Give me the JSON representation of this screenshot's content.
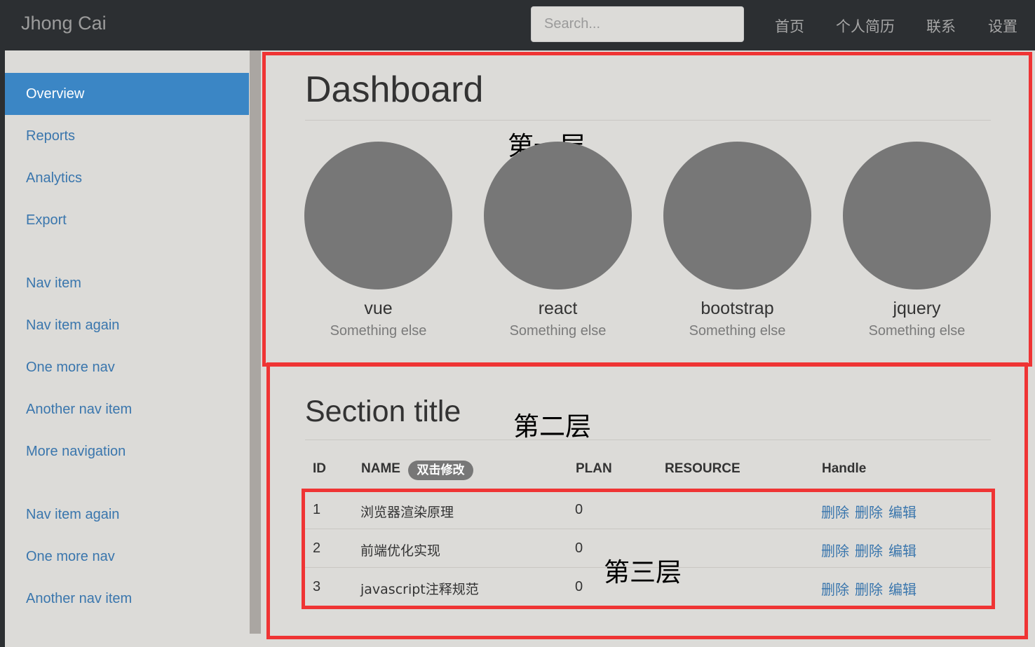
{
  "navbar": {
    "brand": "Jhong Cai",
    "search_placeholder": "Search...",
    "links": [
      "首页",
      "个人简历",
      "联系",
      "设置"
    ]
  },
  "sidebar": {
    "group1": [
      "Overview",
      "Reports",
      "Analytics",
      "Export"
    ],
    "group2": [
      "Nav item",
      "Nav item again",
      "One more nav",
      "Another nav item",
      "More navigation"
    ],
    "group3": [
      "Nav item again",
      "One more nav",
      "Another nav item"
    ],
    "active_item": "Overview"
  },
  "dashboard": {
    "title": "Dashboard",
    "placeholders": [
      {
        "name": "vue",
        "sub": "Something else"
      },
      {
        "name": "react",
        "sub": "Something else"
      },
      {
        "name": "bootstrap",
        "sub": "Something else"
      },
      {
        "name": "jquery",
        "sub": "Something else"
      }
    ]
  },
  "section": {
    "title": "Section title",
    "columns": {
      "id": "ID",
      "name": "NAME",
      "name_badge": "双击修改",
      "plan": "PLAN",
      "resource": "RESOURCE",
      "handle": "Handle"
    },
    "rows": [
      {
        "id": "1",
        "name": "浏览器渲染原理",
        "plan": "0",
        "resource": "",
        "actions": [
          "删除",
          "删除",
          "编辑"
        ]
      },
      {
        "id": "2",
        "name": "前端优化实现",
        "plan": "0",
        "resource": "",
        "actions": [
          "删除",
          "删除",
          "编辑"
        ]
      },
      {
        "id": "3",
        "name": "javascript注释规范",
        "plan": "0",
        "resource": "",
        "actions": [
          "删除",
          "删除",
          "编辑"
        ]
      }
    ]
  },
  "annotations": {
    "layer1": "第一层",
    "layer2": "第二层",
    "layer3": "第三层",
    "box_color": "#ef3434"
  },
  "colors": {
    "accent": "#3b86c5",
    "link": "#3a76ad",
    "navbar_bg": "#2c2f32",
    "page_bg": "#dcdbd8",
    "placeholder_circle": "#777777"
  }
}
